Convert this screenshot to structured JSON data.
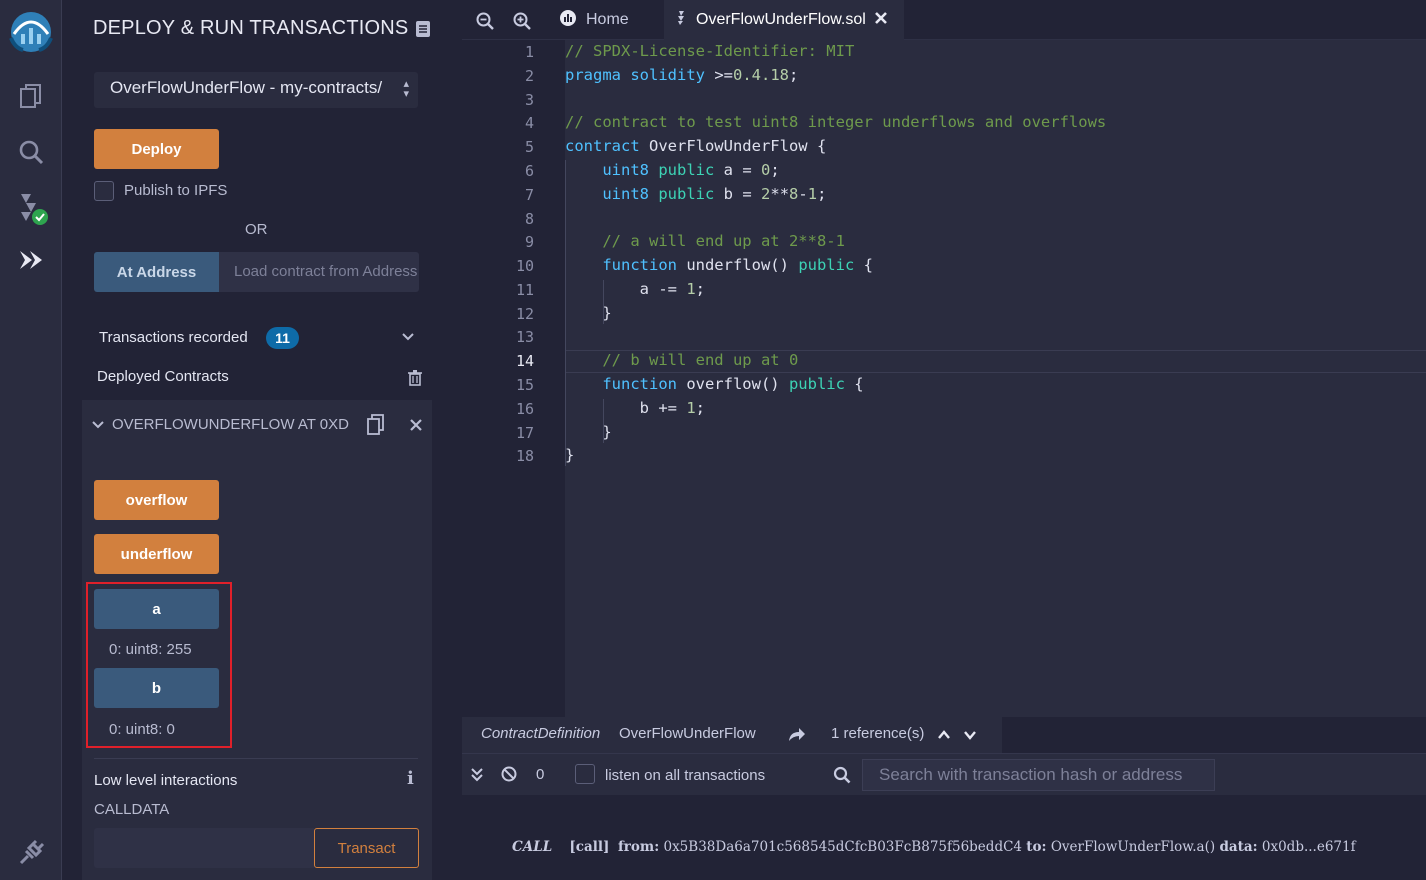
{
  "panel": {
    "title": "DEPLOY & RUN TRANSACTIONS",
    "contract_select": "OverFlowUnderFlow - my-contracts/",
    "deploy_label": "Deploy",
    "publish_label": "Publish to IPFS",
    "or_label": "OR",
    "at_address_label": "At Address",
    "load_placeholder": "Load contract from Address",
    "transactions_label": "Transactions recorded",
    "transactions_count": "11",
    "deployed_label": "Deployed Contracts",
    "instance_title": "OVERFLOWUNDERFLOW AT 0XD",
    "functions": {
      "overflow": "overflow",
      "underflow": "underflow",
      "a": "a",
      "a_result": "0: uint8: 255",
      "b": "b",
      "b_result": "0: uint8: 0"
    },
    "low_level_label": "Low level interactions",
    "calldata_label": "CALLDATA",
    "transact_label": "Transact"
  },
  "tabs": {
    "home": "Home",
    "file": "OverFlowUnderFlow.sol"
  },
  "editor": {
    "line_numbers": [
      "1",
      "2",
      "3",
      "4",
      "5",
      "6",
      "7",
      "8",
      "9",
      "10",
      "11",
      "12",
      "13",
      "14",
      "15",
      "16",
      "17",
      "18"
    ],
    "current_line": "14"
  },
  "refbar": {
    "kind": "ContractDefinition",
    "name": "OverFlowUnderFlow",
    "references": "1 reference(s)"
  },
  "terminal": {
    "pending_count": "0",
    "listen_label": "listen on all transactions",
    "search_placeholder": "Search with transaction hash or address",
    "log": {
      "type": "CALL",
      "call": "[call]",
      "from_label": "from:",
      "from": "0x5B38Da6a701c568545dCfcB03FcB875f56beddC4",
      "to_label": "to:",
      "to": "OverFlowUnderFlow.a()",
      "data_label": "data:",
      "data": "0x0db...e671f"
    }
  }
}
